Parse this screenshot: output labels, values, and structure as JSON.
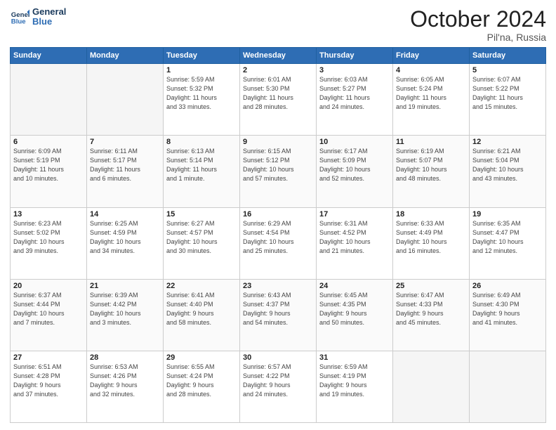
{
  "header": {
    "logo_line1": "General",
    "logo_line2": "Blue",
    "month": "October 2024",
    "location": "Pil'na, Russia"
  },
  "weekdays": [
    "Sunday",
    "Monday",
    "Tuesday",
    "Wednesday",
    "Thursday",
    "Friday",
    "Saturday"
  ],
  "weeks": [
    [
      {
        "day": "",
        "info": ""
      },
      {
        "day": "",
        "info": ""
      },
      {
        "day": "1",
        "info": "Sunrise: 5:59 AM\nSunset: 5:32 PM\nDaylight: 11 hours\nand 33 minutes."
      },
      {
        "day": "2",
        "info": "Sunrise: 6:01 AM\nSunset: 5:30 PM\nDaylight: 11 hours\nand 28 minutes."
      },
      {
        "day": "3",
        "info": "Sunrise: 6:03 AM\nSunset: 5:27 PM\nDaylight: 11 hours\nand 24 minutes."
      },
      {
        "day": "4",
        "info": "Sunrise: 6:05 AM\nSunset: 5:24 PM\nDaylight: 11 hours\nand 19 minutes."
      },
      {
        "day": "5",
        "info": "Sunrise: 6:07 AM\nSunset: 5:22 PM\nDaylight: 11 hours\nand 15 minutes."
      }
    ],
    [
      {
        "day": "6",
        "info": "Sunrise: 6:09 AM\nSunset: 5:19 PM\nDaylight: 11 hours\nand 10 minutes."
      },
      {
        "day": "7",
        "info": "Sunrise: 6:11 AM\nSunset: 5:17 PM\nDaylight: 11 hours\nand 6 minutes."
      },
      {
        "day": "8",
        "info": "Sunrise: 6:13 AM\nSunset: 5:14 PM\nDaylight: 11 hours\nand 1 minute."
      },
      {
        "day": "9",
        "info": "Sunrise: 6:15 AM\nSunset: 5:12 PM\nDaylight: 10 hours\nand 57 minutes."
      },
      {
        "day": "10",
        "info": "Sunrise: 6:17 AM\nSunset: 5:09 PM\nDaylight: 10 hours\nand 52 minutes."
      },
      {
        "day": "11",
        "info": "Sunrise: 6:19 AM\nSunset: 5:07 PM\nDaylight: 10 hours\nand 48 minutes."
      },
      {
        "day": "12",
        "info": "Sunrise: 6:21 AM\nSunset: 5:04 PM\nDaylight: 10 hours\nand 43 minutes."
      }
    ],
    [
      {
        "day": "13",
        "info": "Sunrise: 6:23 AM\nSunset: 5:02 PM\nDaylight: 10 hours\nand 39 minutes."
      },
      {
        "day": "14",
        "info": "Sunrise: 6:25 AM\nSunset: 4:59 PM\nDaylight: 10 hours\nand 34 minutes."
      },
      {
        "day": "15",
        "info": "Sunrise: 6:27 AM\nSunset: 4:57 PM\nDaylight: 10 hours\nand 30 minutes."
      },
      {
        "day": "16",
        "info": "Sunrise: 6:29 AM\nSunset: 4:54 PM\nDaylight: 10 hours\nand 25 minutes."
      },
      {
        "day": "17",
        "info": "Sunrise: 6:31 AM\nSunset: 4:52 PM\nDaylight: 10 hours\nand 21 minutes."
      },
      {
        "day": "18",
        "info": "Sunrise: 6:33 AM\nSunset: 4:49 PM\nDaylight: 10 hours\nand 16 minutes."
      },
      {
        "day": "19",
        "info": "Sunrise: 6:35 AM\nSunset: 4:47 PM\nDaylight: 10 hours\nand 12 minutes."
      }
    ],
    [
      {
        "day": "20",
        "info": "Sunrise: 6:37 AM\nSunset: 4:44 PM\nDaylight: 10 hours\nand 7 minutes."
      },
      {
        "day": "21",
        "info": "Sunrise: 6:39 AM\nSunset: 4:42 PM\nDaylight: 10 hours\nand 3 minutes."
      },
      {
        "day": "22",
        "info": "Sunrise: 6:41 AM\nSunset: 4:40 PM\nDaylight: 9 hours\nand 58 minutes."
      },
      {
        "day": "23",
        "info": "Sunrise: 6:43 AM\nSunset: 4:37 PM\nDaylight: 9 hours\nand 54 minutes."
      },
      {
        "day": "24",
        "info": "Sunrise: 6:45 AM\nSunset: 4:35 PM\nDaylight: 9 hours\nand 50 minutes."
      },
      {
        "day": "25",
        "info": "Sunrise: 6:47 AM\nSunset: 4:33 PM\nDaylight: 9 hours\nand 45 minutes."
      },
      {
        "day": "26",
        "info": "Sunrise: 6:49 AM\nSunset: 4:30 PM\nDaylight: 9 hours\nand 41 minutes."
      }
    ],
    [
      {
        "day": "27",
        "info": "Sunrise: 6:51 AM\nSunset: 4:28 PM\nDaylight: 9 hours\nand 37 minutes."
      },
      {
        "day": "28",
        "info": "Sunrise: 6:53 AM\nSunset: 4:26 PM\nDaylight: 9 hours\nand 32 minutes."
      },
      {
        "day": "29",
        "info": "Sunrise: 6:55 AM\nSunset: 4:24 PM\nDaylight: 9 hours\nand 28 minutes."
      },
      {
        "day": "30",
        "info": "Sunrise: 6:57 AM\nSunset: 4:22 PM\nDaylight: 9 hours\nand 24 minutes."
      },
      {
        "day": "31",
        "info": "Sunrise: 6:59 AM\nSunset: 4:19 PM\nDaylight: 9 hours\nand 19 minutes."
      },
      {
        "day": "",
        "info": ""
      },
      {
        "day": "",
        "info": ""
      }
    ]
  ]
}
